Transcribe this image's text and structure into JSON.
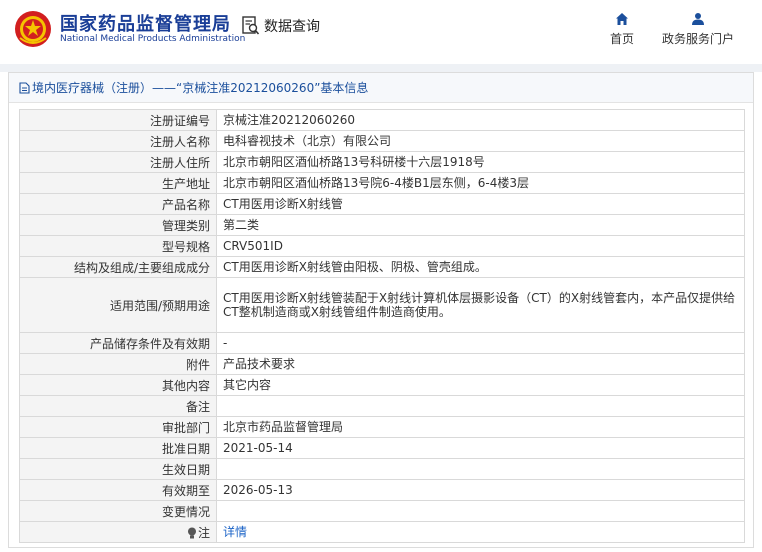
{
  "header": {
    "brand_cn": "国家药品监督管理局",
    "brand_en": "National Medical Products Administration",
    "query_label": "数据查询",
    "nav": [
      {
        "label": "首页",
        "icon": "home-icon"
      },
      {
        "label": "政务服务门户",
        "icon": "user-icon"
      }
    ]
  },
  "colors": {
    "brand": "#1a3e97",
    "link": "#1b63c7",
    "label_bg": "#f4f4f4"
  },
  "panel": {
    "title": "境内医疗器械（注册）——“京械注准20212060260”基本信息"
  },
  "details": [
    {
      "label": "注册证编号",
      "value": "京械注准20212060260"
    },
    {
      "label": "注册人名称",
      "value": "电科睿视技术（北京）有限公司"
    },
    {
      "label": "注册人住所",
      "value": "北京市朝阳区酒仙桥路13号科研楼十六层1918号"
    },
    {
      "label": "生产地址",
      "value": "北京市朝阳区酒仙桥路13号院6-4楼B1层东侧，6-4楼3层"
    },
    {
      "label": "产品名称",
      "value": "CT用医用诊断X射线管"
    },
    {
      "label": "管理类别",
      "value": "第二类"
    },
    {
      "label": "型号规格",
      "value": "CRV501ID"
    },
    {
      "label": "结构及组成/主要组成成分",
      "value": "CT用医用诊断X射线管由阳极、阴极、管壳组成。"
    },
    {
      "label": "适用范围/预期用途",
      "value": "CT用医用诊断X射线管装配于X射线计算机体层摄影设备（CT）的X射线管套内，本产品仅提供给CT整机制造商或X射线管组件制造商使用。"
    },
    {
      "label": "产品储存条件及有效期",
      "value": "-"
    },
    {
      "label": "附件",
      "value": "产品技术要求"
    },
    {
      "label": "其他内容",
      "value": "其它内容"
    },
    {
      "label": "备注",
      "value": ""
    },
    {
      "label": "审批部门",
      "value": "北京市药品监督管理局"
    },
    {
      "label": "批准日期",
      "value": "2021-05-14"
    },
    {
      "label": "生效日期",
      "value": ""
    },
    {
      "label": "有效期至",
      "value": "2026-05-13"
    },
    {
      "label": "变更情况",
      "value": ""
    }
  ],
  "note": {
    "label": "注",
    "link": "详情"
  }
}
